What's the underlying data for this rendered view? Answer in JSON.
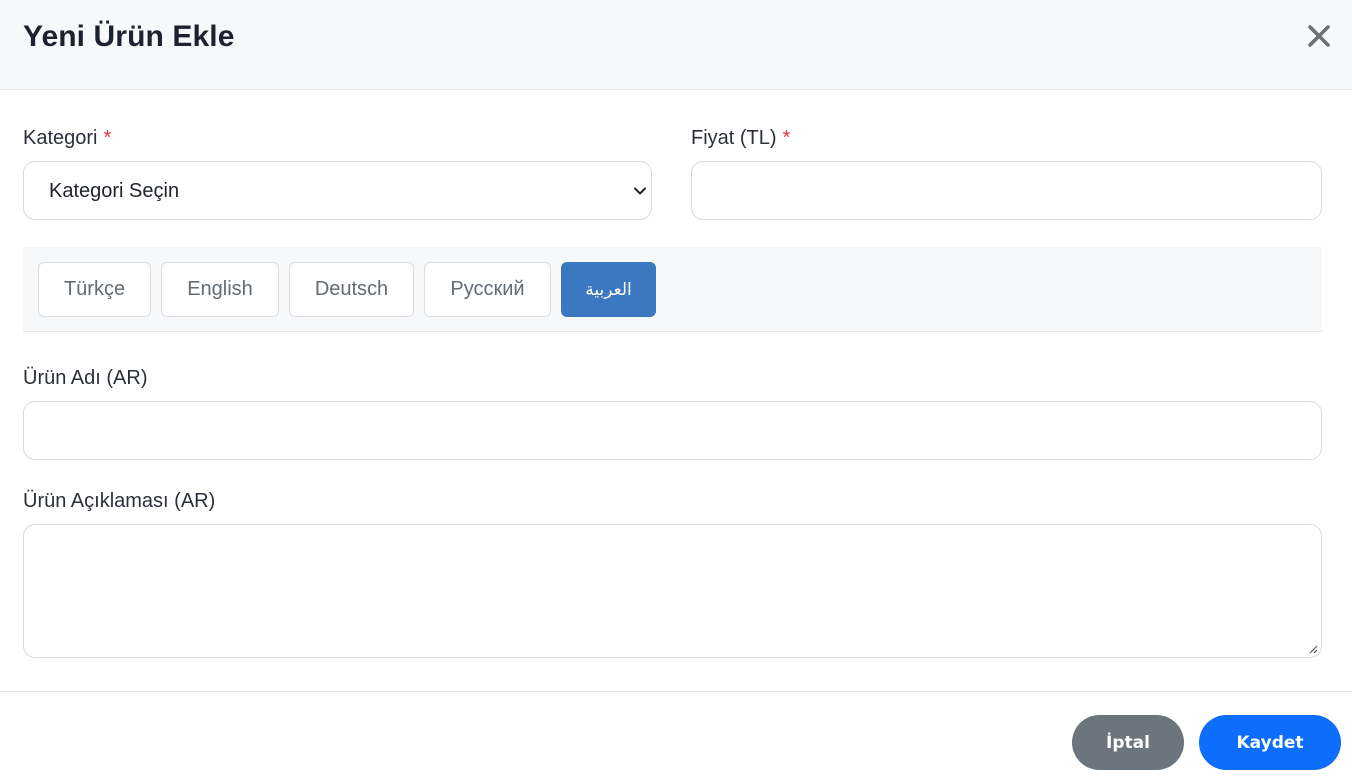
{
  "modal": {
    "title": "Yeni Ürün Ekle",
    "close_icon": "close-icon"
  },
  "form": {
    "category": {
      "label": "Kategori",
      "required_mark": "*",
      "selected": "Kategori Seçin"
    },
    "price": {
      "label": "Fiyat (TL)",
      "required_mark": "*",
      "value": ""
    },
    "product_name": {
      "label": "Ürün Adı (AR)",
      "value": ""
    },
    "product_description": {
      "label": "Ürün Açıklaması (AR)",
      "value": ""
    }
  },
  "language_tabs": [
    {
      "label": "Türkçe",
      "active": false
    },
    {
      "label": "English",
      "active": false
    },
    {
      "label": "Deutsch",
      "active": false
    },
    {
      "label": "Русский",
      "active": false
    },
    {
      "label": "العربية",
      "active": true
    }
  ],
  "footer": {
    "cancel_label": "İptal",
    "save_label": "Kaydet"
  },
  "colors": {
    "active_tab": "#3c78c0",
    "cancel_button": "#6c757d",
    "save_button": "#0d6efd",
    "required": "#dc3545"
  }
}
